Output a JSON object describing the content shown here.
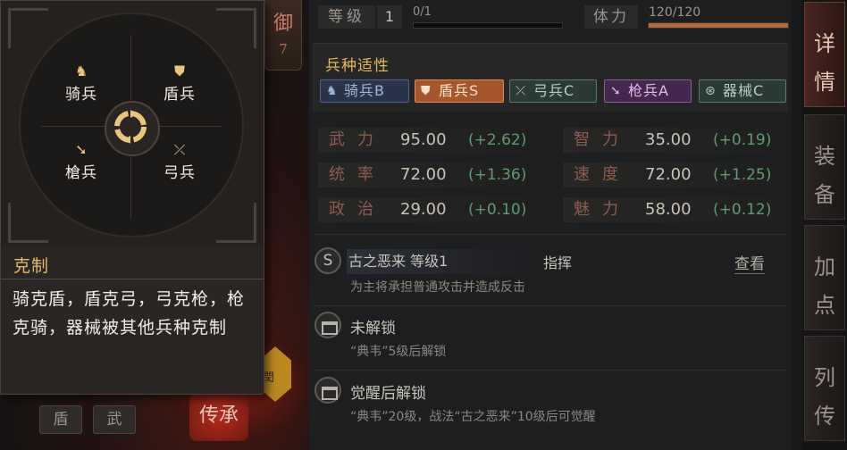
{
  "behind": {
    "defense_char": "御",
    "defense_value": "7",
    "hex_text": "閏",
    "legacy_label": "传承",
    "mini_tags": [
      "盾",
      "武"
    ]
  },
  "popup": {
    "units": {
      "cavalry": "骑兵",
      "shield": "盾兵",
      "spear": "槍兵",
      "archer": "弓兵"
    },
    "counter_title": "克制",
    "counter_desc": "骑克盾，盾克弓，弓克枪，枪克骑，器械被其他兵种克制"
  },
  "panel": {
    "level_label": "等级",
    "level_value": "1",
    "exp_text": "0/1",
    "exp_progress": 0.0,
    "stamina_label": "体力",
    "stamina_text": "120/120",
    "stamina_progress": 1.0,
    "aptitude": {
      "title": "兵种适性",
      "tags": [
        {
          "label": "骑兵B",
          "icon": "horse-icon"
        },
        {
          "label": "盾兵S",
          "icon": "shield-icon"
        },
        {
          "label": "弓兵C",
          "icon": "bow-icon"
        },
        {
          "label": "枪兵A",
          "icon": "spear-icon"
        },
        {
          "label": "器械C",
          "icon": "wheel-icon"
        }
      ]
    },
    "stats": {
      "force": {
        "name": "武力",
        "value": "95.00",
        "bonus": "(+2.62)"
      },
      "leadership": {
        "name": "统率",
        "value": "72.00",
        "bonus": "(+1.36)"
      },
      "politics": {
        "name": "政治",
        "value": "29.00",
        "bonus": "(+0.10)"
      },
      "intellect": {
        "name": "智力",
        "value": "35.00",
        "bonus": "(+0.19)"
      },
      "speed": {
        "name": "速度",
        "value": "72.00",
        "bonus": "(+1.25)"
      },
      "charm": {
        "name": "魅力",
        "value": "58.00",
        "bonus": "(+0.12)"
      }
    },
    "skills": [
      {
        "grade": "S",
        "name": "古之恶来 等级1",
        "type": "指挥",
        "view": "查看",
        "desc": "为主将承担普通攻击并造成反击"
      },
      {
        "title": "未解锁",
        "desc": "“典韦”5级后解锁"
      },
      {
        "title": "觉醒后解锁",
        "desc": "“典韦”20级，战法“古之恶来”10级后可觉醒"
      }
    ]
  },
  "side_tabs": [
    {
      "label": [
        "详",
        "情"
      ],
      "active": true
    },
    {
      "label": [
        "装",
        "备"
      ],
      "active": false
    },
    {
      "label": [
        "加",
        "点"
      ],
      "active": false
    },
    {
      "label": [
        "列",
        "传"
      ],
      "active": false
    }
  ],
  "colors": {
    "gold": "#e4b65c",
    "bonus_green": "#5f9a70",
    "stat_name": "#8e5c4e",
    "shield_tag": "#a4562d"
  }
}
